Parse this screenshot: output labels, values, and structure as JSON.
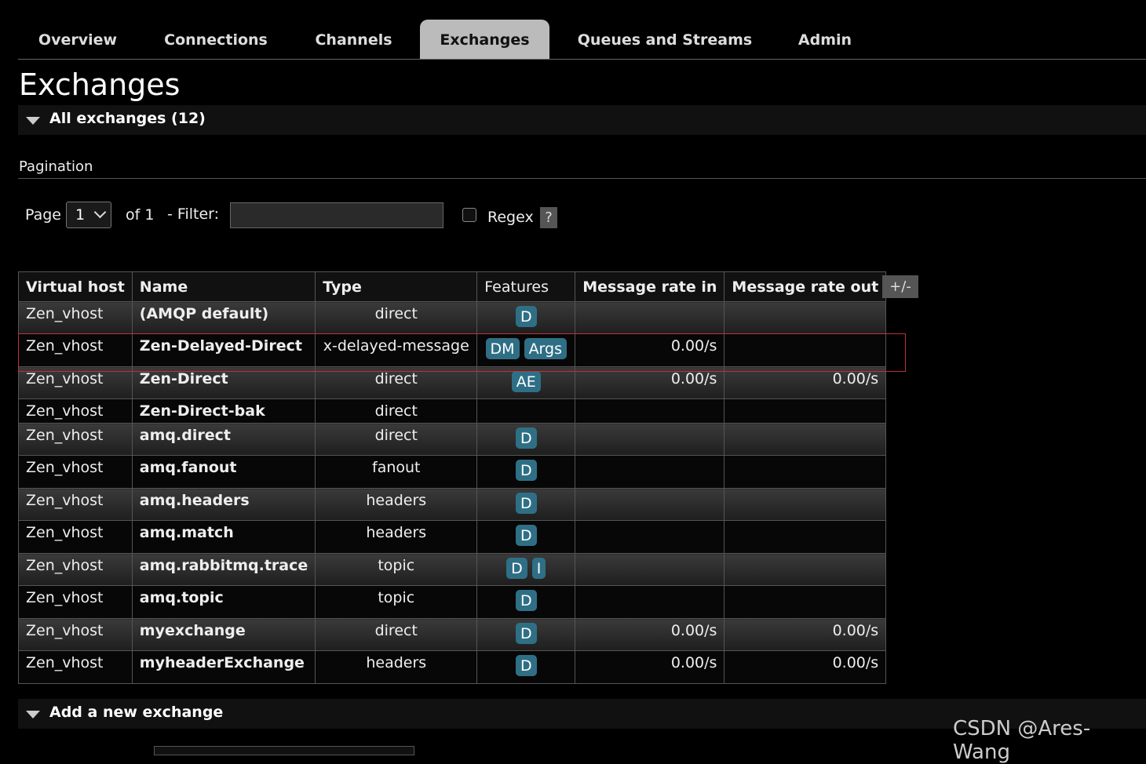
{
  "nav": {
    "tabs": [
      {
        "label": "Overview"
      },
      {
        "label": "Connections"
      },
      {
        "label": "Channels"
      },
      {
        "label": "Exchanges"
      },
      {
        "label": "Queues and Streams"
      },
      {
        "label": "Admin"
      }
    ],
    "active": "Exchanges"
  },
  "page_title": "Exchanges",
  "all_exchanges": {
    "label": "All exchanges (12)"
  },
  "pagination": {
    "label": "Pagination",
    "page_label": "Page",
    "page_value": "1",
    "of_label": "of 1",
    "filter_label": "- Filter:",
    "filter_value": "",
    "regex_label": "Regex",
    "regex_checked": false,
    "help_label": "?"
  },
  "table": {
    "columns": [
      "Virtual host",
      "Name",
      "Type",
      "Features",
      "Message rate in",
      "Message rate out"
    ],
    "column_toggle_label": "+/-",
    "rows": [
      {
        "vhost": "Zen_vhost",
        "name": "(AMQP default)",
        "type": "direct",
        "features": [
          "D"
        ],
        "rate_in": "",
        "rate_out": ""
      },
      {
        "vhost": "Zen_vhost",
        "name": "Zen-Delayed-Direct",
        "type": "x-delayed-message",
        "features": [
          "DM",
          "Args"
        ],
        "rate_in": "0.00/s",
        "rate_out": ""
      },
      {
        "vhost": "Zen_vhost",
        "name": "Zen-Direct",
        "type": "direct",
        "features": [
          "AE"
        ],
        "rate_in": "0.00/s",
        "rate_out": "0.00/s"
      },
      {
        "vhost": "Zen_vhost",
        "name": "Zen-Direct-bak",
        "type": "direct",
        "features": [],
        "rate_in": "",
        "rate_out": ""
      },
      {
        "vhost": "Zen_vhost",
        "name": "amq.direct",
        "type": "direct",
        "features": [
          "D"
        ],
        "rate_in": "",
        "rate_out": ""
      },
      {
        "vhost": "Zen_vhost",
        "name": "amq.fanout",
        "type": "fanout",
        "features": [
          "D"
        ],
        "rate_in": "",
        "rate_out": ""
      },
      {
        "vhost": "Zen_vhost",
        "name": "amq.headers",
        "type": "headers",
        "features": [
          "D"
        ],
        "rate_in": "",
        "rate_out": ""
      },
      {
        "vhost": "Zen_vhost",
        "name": "amq.match",
        "type": "headers",
        "features": [
          "D"
        ],
        "rate_in": "",
        "rate_out": ""
      },
      {
        "vhost": "Zen_vhost",
        "name": "amq.rabbitmq.trace",
        "type": "topic",
        "features": [
          "D",
          "I"
        ],
        "rate_in": "",
        "rate_out": ""
      },
      {
        "vhost": "Zen_vhost",
        "name": "amq.topic",
        "type": "topic",
        "features": [
          "D"
        ],
        "rate_in": "",
        "rate_out": ""
      },
      {
        "vhost": "Zen_vhost",
        "name": "myexchange",
        "type": "direct",
        "features": [
          "D"
        ],
        "rate_in": "0.00/s",
        "rate_out": "0.00/s"
      },
      {
        "vhost": "Zen_vhost",
        "name": "myheaderExchange",
        "type": "headers",
        "features": [
          "D"
        ],
        "rate_in": "0.00/s",
        "rate_out": "0.00/s"
      }
    ]
  },
  "add_exchange": {
    "label": "Add a new exchange"
  },
  "watermark": "CSDN @Ares-Wang",
  "colors": {
    "badge": "#2f6f86",
    "highlight": "#c0303a",
    "active_tab": "#bbbbbb"
  }
}
